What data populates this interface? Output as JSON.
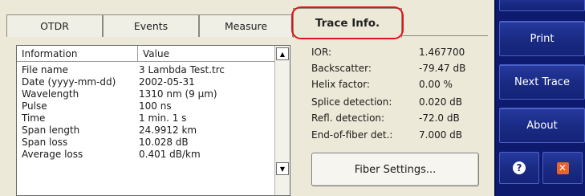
{
  "tabs": [
    {
      "label": "OTDR",
      "active": false
    },
    {
      "label": "Events",
      "active": false
    },
    {
      "label": "Measure",
      "active": false
    },
    {
      "label": "Trace Info.",
      "active": true
    }
  ],
  "info_table": {
    "headers": [
      "Information",
      "Value"
    ],
    "rows": [
      {
        "name": "File name",
        "value": "3 Lambda Test.trc"
      },
      {
        "name": "Date (yyyy-mm-dd)",
        "value": "2002-05-31"
      },
      {
        "name": "Wavelength",
        "value": "1310 nm (9 µm)"
      },
      {
        "name": "Pulse",
        "value": "100 ns"
      },
      {
        "name": "Time",
        "value": "1 min. 1 s"
      },
      {
        "name": "Span length",
        "value": "24.9912 km"
      },
      {
        "name": "Span loss",
        "value": "10.028 dB"
      },
      {
        "name": "Average loss",
        "value": "0.401 dB/km"
      }
    ]
  },
  "settings": [
    {
      "label": "IOR:",
      "value": "1.467700"
    },
    {
      "label": "Backscatter:",
      "value": "-79.47 dB"
    },
    {
      "label": "Helix factor:",
      "value": "0.00 %"
    },
    {
      "label": "Splice detection:",
      "value": "0.020 dB"
    },
    {
      "label": "Refl. detection:",
      "value": "-72.0 dB"
    },
    {
      "label": "End-of-fiber det.:",
      "value": "7.000 dB"
    }
  ],
  "fiber_settings_label": "Fiber Settings...",
  "sidebar": {
    "buttons": [
      {
        "label": "Print"
      },
      {
        "label": "Next Trace"
      },
      {
        "label": "About"
      }
    ],
    "help_icon": "help-icon",
    "close_icon": "close-icon"
  },
  "colors": {
    "panel_bg": "#ece9d8",
    "sidebar_bg": "#0d1a6e",
    "highlight": "#e2141a"
  }
}
